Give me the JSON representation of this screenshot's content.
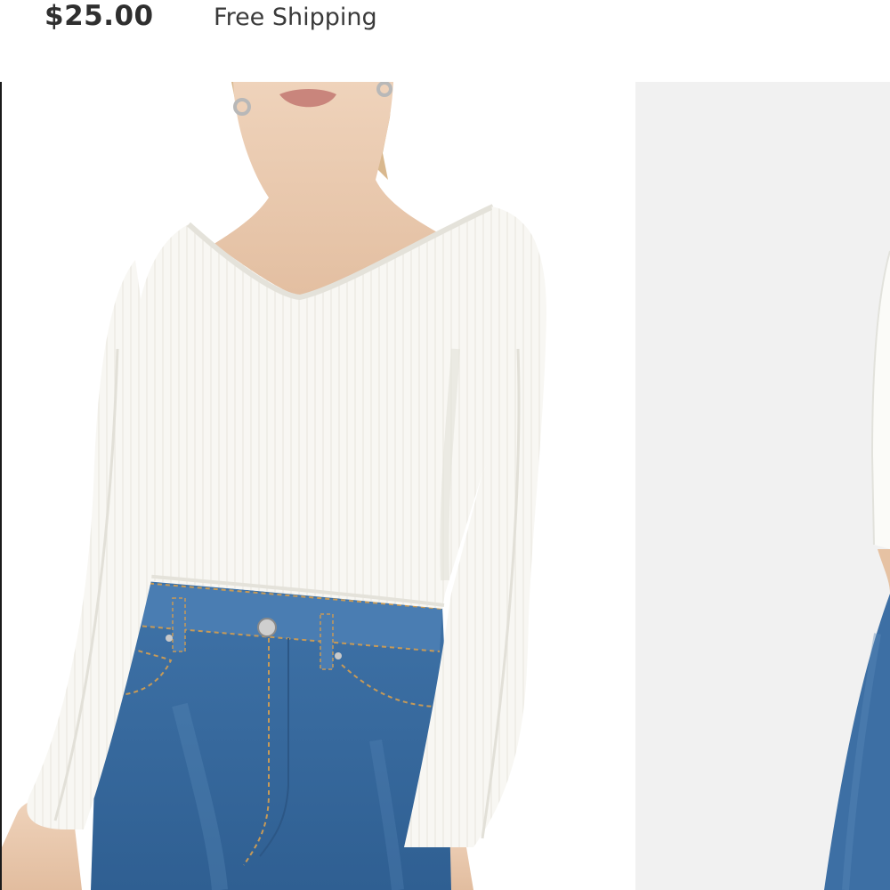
{
  "listing": {
    "price": "$25.00",
    "shipping": "Free Shipping"
  },
  "gallery": {
    "images": [
      {
        "subject": "product-photo-white-ribbed-v-neck-crop-top-front"
      },
      {
        "subject": "product-photo-white-ribbed-crop-top-partial"
      }
    ]
  },
  "colors": {
    "top": "#f7f6f2",
    "denim": "#3b6fa3",
    "skin": "#e8c6a8",
    "background_alt": "#f1f1f1"
  }
}
